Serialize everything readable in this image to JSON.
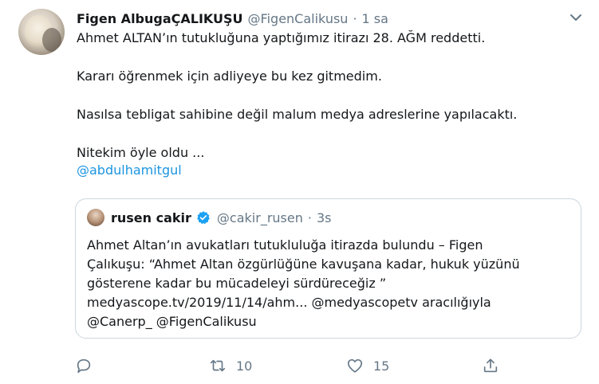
{
  "tweet": {
    "author_name": "Figen AlbugaÇALIKUŞU",
    "author_handle": "@FigenCalikusu",
    "separator": "·",
    "time": "1 sa",
    "paragraphs": [
      "Ahmet ALTAN’ın tutukluğuna yaptığımız itirazı 28. AĞM reddetti.",
      "Kararı öğrenmek için adliyeye bu kez gitmedim.",
      "Nasılsa tebligat sahibine değil malum medya adreslerine yapılacaktı.",
      "Nitekim öyle oldu ..."
    ],
    "mention": "@abdulhamitgul"
  },
  "quote": {
    "author_name": "rusen cakir",
    "author_handle": "@cakir_rusen",
    "separator": "·",
    "time": "3s",
    "lines": [
      "Ahmet Altan’ın avukatları tutukluluğa itirazda bulundu – Figen",
      "Çalıkuşu: “Ahmet Altan özgürlüğüne kavuşana kadar, hukuk yüzünü",
      "gösterene kadar bu mücadeleyi sürdüreceğiz ”",
      "medyascope.tv/2019/11/14/ahm... @medyascopetv aracılığıyla",
      "@Canerp_ @FigenCalikusu"
    ]
  },
  "actions": {
    "retweet_count": "10",
    "like_count": "15"
  },
  "icons": {
    "caret": "chevron-down-icon",
    "verified": "verified-badge-icon",
    "reply": "reply-icon",
    "retweet": "retweet-icon",
    "like": "heart-icon",
    "share": "share-icon"
  },
  "colors": {
    "text": "#14171a",
    "secondary": "#657786",
    "link": "#1b95e0",
    "verified": "#1da1f2",
    "border": "#ccd6dd"
  }
}
